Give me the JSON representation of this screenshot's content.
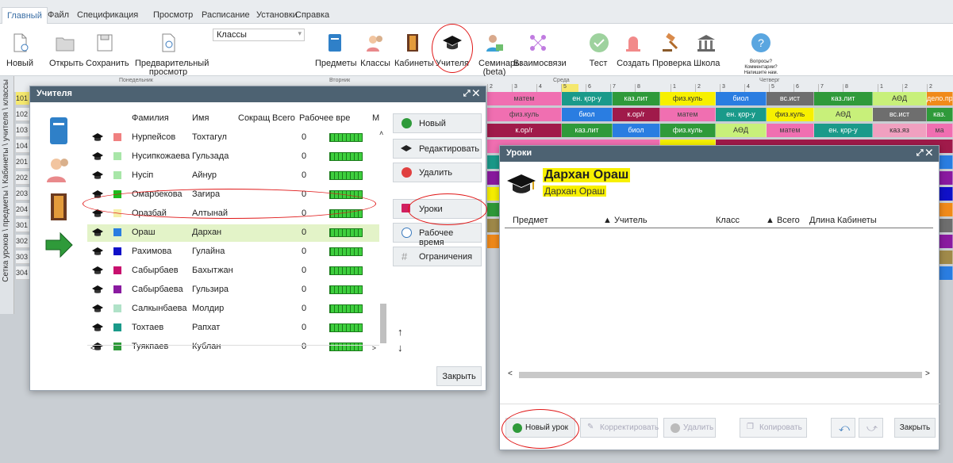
{
  "menubar": {
    "items": [
      "Главный",
      "Файл",
      "Спецификация",
      "Просмотр",
      "Расписание",
      "Установки",
      "Справка"
    ],
    "active": "Главный"
  },
  "ribbon": {
    "new": "Новый",
    "open": "Открыть",
    "save": "Сохранить",
    "preview": "Предварительный просмотр",
    "dropdown_value": "Классы",
    "subjects": "Предметы",
    "classes": "Классы",
    "rooms": "Кабинеты",
    "teachers": "Учителя",
    "seminars": "Семинары (beta)",
    "relations": "Взаимосвязи",
    "test": "Тест",
    "create": "Создать",
    "check": "Проверка",
    "school": "Школа",
    "questions": "Вопросы? Комментарии? Напишите нам."
  },
  "grid": {
    "day_headers": [
      "Понедельник",
      "Вторник",
      "Среда",
      "Четверг"
    ],
    "side_tabs": "Сетка уроков \\ предметы \\ Кабинеты \\ учителя \\ классы",
    "row_labels": [
      "101",
      "102",
      "103",
      "104",
      "201",
      "202",
      "203",
      "204",
      "301",
      "302",
      "303",
      "304"
    ],
    "slots": [
      "2",
      "3",
      "4",
      "5",
      "6",
      "7",
      "8",
      "1",
      "2",
      "3",
      "4",
      "5",
      "6",
      "7",
      "8",
      "1",
      "2",
      "2"
    ],
    "rows": [
      [
        "матем",
        "ен. қор-у",
        "каз.лит",
        "физ.куль",
        "биол",
        "вс.ист",
        "каз.лит",
        "АӨД",
        "дело.пр"
      ],
      [
        "физ.куль",
        "биол",
        "к.ор/г",
        "матем",
        "ен. қор-у",
        "физ.куль",
        "АӨД",
        "вс.ист",
        "каз."
      ],
      [
        "к.ор/г",
        "каз.лит",
        "биол",
        "физ.куль",
        "АӨД",
        "матем",
        "ен. қор-у",
        "каз.яз",
        "ма"
      ]
    ]
  },
  "teachers_dialog": {
    "title": "Учителя",
    "columns": [
      "Фамилия",
      "Имя",
      "Сокращен",
      "Всего",
      "Рабочее вре",
      "М"
    ],
    "rows": [
      {
        "surname": "Нурпейсов",
        "name": "Тохтагул",
        "total": "0",
        "color": "#f08080"
      },
      {
        "surname": "Нусипкожаева",
        "name": "Гульзада",
        "total": "0",
        "color": "#a8e6a8"
      },
      {
        "surname": "Нусіп",
        "name": "Айнур",
        "total": "0",
        "color": "#a8e6a8"
      },
      {
        "surname": "Омарбекова",
        "name": "Зағира",
        "total": "0",
        "color": "#1dbb1d"
      },
      {
        "surname": "Оразбай",
        "name": "Алтынай",
        "total": "0",
        "color": "#f5f0a8"
      },
      {
        "surname": "Ораш",
        "name": "Дархан",
        "total": "0",
        "color": "#2a7de1"
      },
      {
        "surname": "Рахимова",
        "name": "Гулайна",
        "total": "0",
        "color": "#1010c8"
      },
      {
        "surname": "Сабырбаев",
        "name": "Бахытжан",
        "total": "0",
        "color": "#c8106e"
      },
      {
        "surname": "Сабырбаева",
        "name": "Гульзира",
        "total": "0",
        "color": "#8a1aa0"
      },
      {
        "surname": "Салкынбаева",
        "name": "Молдир",
        "total": "0",
        "color": "#b0e2c8"
      },
      {
        "surname": "Тохтаев",
        "name": "Рапхат",
        "total": "0",
        "color": "#1a9a8a"
      },
      {
        "surname": "Туякпаев",
        "name": "Кублан",
        "total": "0",
        "color": "#2f9a3a"
      }
    ],
    "selected_index": 5,
    "buttons": {
      "new": "Новый",
      "edit": "Редактировать",
      "delete": "Удалить",
      "lessons": "Уроки",
      "worktime": "Рабочее время",
      "constraints": "Ограничения",
      "close": "Закрыть"
    }
  },
  "lessons_dialog": {
    "title": "Уроки",
    "teacher_name": "Дархан Ораш",
    "teacher_subtitle": "Дархан Ораш",
    "columns": [
      "Предмет",
      "▲ Учитель",
      "Класс",
      "▲ Всего",
      "Длина",
      "Кабинеты"
    ],
    "buttons": {
      "new_lesson": "Новый урок",
      "correct": "Корректировать",
      "delete": "Удалить",
      "copy": "Копировать",
      "close": "Закрыть"
    }
  },
  "colors": {
    "title_bar": "#4d6272",
    "highlight": "#f7f000",
    "annotation": "#e01818"
  }
}
